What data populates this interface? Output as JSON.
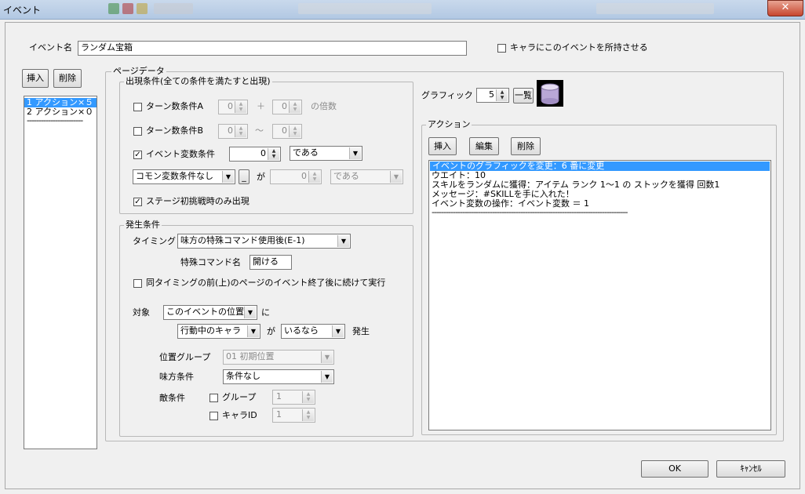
{
  "window": {
    "title": "イベント",
    "close": "✕"
  },
  "event_name": {
    "label": "イベント名",
    "value": "ランダム宝箱"
  },
  "own_event": {
    "label": "キャラにこのイベントを所持させる",
    "checked": false
  },
  "pages": {
    "insert": "挿入",
    "delete": "削除",
    "items": [
      "1 アクション×５",
      "2 アクション×０"
    ],
    "end": "------------------------"
  },
  "page_data": {
    "title": "ページデータ",
    "appear": {
      "title": "出現条件(全ての条件を満たすと出現)",
      "turn_a": {
        "label": "ターン数条件A",
        "v1": "0",
        "plus": "＋",
        "v2": "0",
        "suffix": "の倍数"
      },
      "turn_b": {
        "label": "ターン数条件B",
        "v1": "0",
        "tilde": "～",
        "v2": "0"
      },
      "event_var": {
        "label": "イベント変数条件",
        "value": "0",
        "compare": "である"
      },
      "common_var": {
        "name": "コモン変数条件なし",
        "small_btn": "_",
        "ga": "が",
        "value": "0",
        "compare": "である"
      },
      "stage_first": {
        "label": "ステージ初挑戦時のみ出現"
      }
    },
    "occur": {
      "title": "発生条件",
      "timing_label": "タイミング",
      "timing_value": "味方の特殊コマンド使用後(E-1)",
      "cmd_label": "特殊コマンド名",
      "cmd_value": "開ける",
      "same_timing": "同タイミングの前(上)のページのイベント終了後に続けて実行",
      "target_label": "対象",
      "target_value": "このイベントの位置",
      "ni": "に",
      "actor_value": "行動中のキャラ",
      "ga": "が",
      "cond_value": "いるなら",
      "hassei": "発生",
      "pos_group_label": "位置グループ",
      "pos_group_value": "01 初期位置",
      "ally_label": "味方条件",
      "ally_value": "条件なし",
      "enemy_label": "敵条件",
      "group_label": "グループ",
      "group_value": "1",
      "chara_label": "キャラID",
      "chara_value": "1"
    },
    "graphic": {
      "label": "グラフィック",
      "value": "5",
      "list_btn": "一覧"
    },
    "action": {
      "title": "アクション",
      "insert": "挿入",
      "edit": "編集",
      "delete": "削除",
      "items": [
        "イベントのグラフィックを変更：6 番に変更",
        "ウエイト：10",
        "スキルをランダムに獲得：アイテム ランク 1～1 の ストックを獲得 回数1",
        "メッセージ：#SKILLを手に入れた！",
        "イベント変数の操作：イベント変数 ＝ 1"
      ],
      "end": "------------------------------------------------------------------------------------"
    }
  },
  "footer": {
    "ok": "OK",
    "cancel": "ｷｬﾝｾﾙ"
  }
}
